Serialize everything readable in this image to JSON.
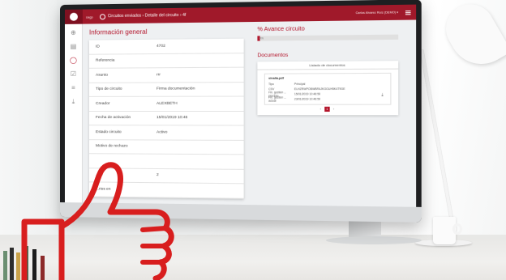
{
  "topbar": {
    "app_name": "sagp",
    "breadcrumb": "Circuitos enviados › Detalle del circuito › 4f",
    "user": "Carlos Alvarez Ruiz (DEMO) ▾"
  },
  "sidebar": {
    "items": [
      {
        "name": "home",
        "icon": "circle-arrow-icon"
      },
      {
        "name": "documents",
        "icon": "document-icon"
      },
      {
        "name": "circuits",
        "icon": "ring-icon",
        "active": true
      },
      {
        "name": "tasks",
        "icon": "check-icon"
      },
      {
        "name": "list",
        "icon": "list-icon"
      },
      {
        "name": "download",
        "icon": "download-icon"
      }
    ]
  },
  "general": {
    "title": "Información general",
    "rows": [
      {
        "key": "ID",
        "value": "4702"
      },
      {
        "key": "Referencia",
        "value": ""
      },
      {
        "key": "Asunto",
        "value": "rrr"
      },
      {
        "key": "Tipo de circuito",
        "value": "Firma documentación"
      },
      {
        "key": "Creador",
        "value": "ALEXBETH"
      },
      {
        "key": "Fecha de activación",
        "value": "15/01/2019 10:46"
      },
      {
        "key": "Estado circuito",
        "value": "Activo"
      },
      {
        "key": "Motivo de rechazo",
        "value": ""
      },
      {
        "key": "",
        "value": ""
      },
      {
        "key": "...cs",
        "value": "2"
      },
      {
        "key": "...rios en",
        "value": ""
      }
    ]
  },
  "advance": {
    "title": "% Avance circuito",
    "value_label": "0%",
    "progress": 0.02
  },
  "documents": {
    "title": "Documentos",
    "table_header": "Listado de documentos",
    "doc": {
      "name": "sinalia.pdf",
      "lines": [
        {
          "key": "Tipo",
          "value": "Principal"
        },
        {
          "key": "CSV",
          "value": "ELHZRWPOBWBR4JKGGUH5K4T9GE"
        },
        {
          "key": "Fin. gestión ... proceso",
          "value": "15/01/2019 10:46:50"
        },
        {
          "key": "Fin. gestión ... actual",
          "value": "23/01/2019 10:46:50"
        }
      ]
    },
    "pager": {
      "prev": "‹",
      "current": "1",
      "next": "›"
    }
  },
  "colors": {
    "brand": "#a0192a",
    "accent": "#b3142a",
    "thumb": "#d81e1e"
  }
}
